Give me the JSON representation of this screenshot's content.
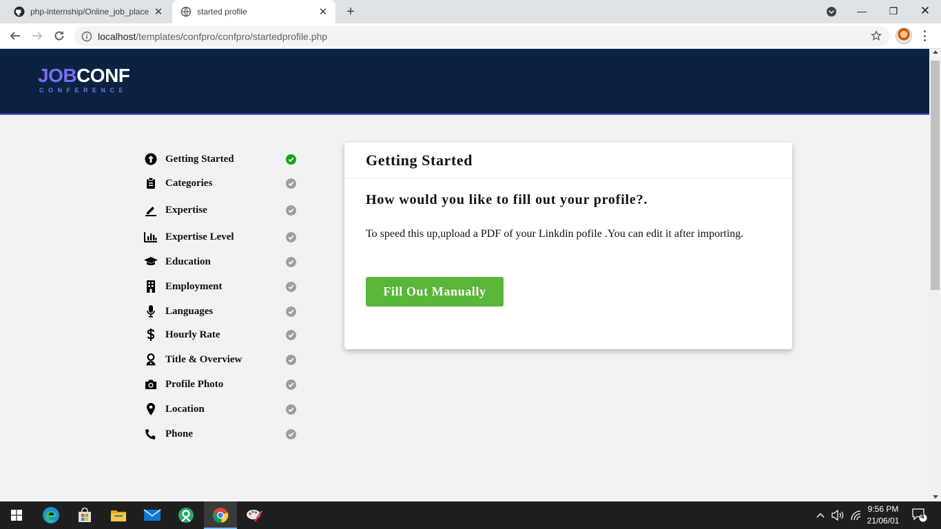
{
  "browser": {
    "tabs": [
      {
        "title": "php-internship/Online_job_place",
        "icon": "github-icon",
        "active": false
      },
      {
        "title": "started profile",
        "icon": "globe-icon",
        "active": true
      }
    ],
    "url_host": "localhost",
    "url_path": "/templates/confpro/confpro/startedprofile.php"
  },
  "site": {
    "logo_part1": "JOB",
    "logo_part2": "CONF",
    "logo_sub": "CONFERENCE"
  },
  "steps": [
    {
      "label": "Getting Started",
      "icon": "arrow-up-circle-icon",
      "done": true
    },
    {
      "label": "Categories",
      "icon": "clipboard-icon",
      "done": false
    },
    {
      "label": "Expertise",
      "icon": "pencil-icon",
      "done": false
    },
    {
      "label": "Expertise Level",
      "icon": "bar-chart-icon",
      "done": false
    },
    {
      "label": "Education",
      "icon": "graduation-cap-icon",
      "done": false
    },
    {
      "label": "Employment",
      "icon": "building-icon",
      "done": false
    },
    {
      "label": "Languages",
      "icon": "microphone-icon",
      "done": false
    },
    {
      "label": "Hourly Rate",
      "icon": "dollar-icon",
      "done": false
    },
    {
      "label": "Title & Overview",
      "icon": "user-icon",
      "done": false
    },
    {
      "label": "Profile Photo",
      "icon": "camera-icon",
      "done": false
    },
    {
      "label": "Location",
      "icon": "map-pin-icon",
      "done": false
    },
    {
      "label": "Phone",
      "icon": "phone-icon",
      "done": false
    }
  ],
  "card": {
    "title": "Getting Started",
    "question": "How would you like to fill out your profile?.",
    "description": "To speed this up,upload a PDF of your Linkdin pofile .You can edit it after importing.",
    "button_label": "Fill Out Manually"
  },
  "taskbar": {
    "time": "9:56 PM",
    "date": "21/06/01",
    "notification_count": "4"
  },
  "colors": {
    "header_bg": "#0b2340",
    "logo_accent": "#7b6cf6",
    "button_green": "#58b638",
    "check_done": "#15a318",
    "check_pending": "#9e9e9e"
  }
}
